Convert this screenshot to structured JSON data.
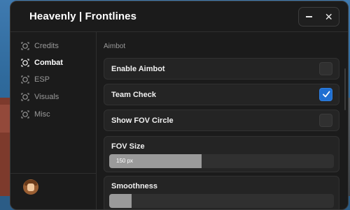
{
  "window": {
    "title": "Heavenly | Frontlines",
    "controls": {
      "minimize_icon": "minus-icon",
      "close_icon": "close-icon",
      "close_glyph": "✕"
    }
  },
  "sidebar": {
    "items": [
      {
        "label": "Credits",
        "icon": "target-icon",
        "active": false
      },
      {
        "label": "Combat",
        "icon": "target-icon",
        "active": true
      },
      {
        "label": "ESP",
        "icon": "target-icon",
        "active": false
      },
      {
        "label": "Visuals",
        "icon": "target-icon",
        "active": false
      },
      {
        "label": "Misc",
        "icon": "target-icon",
        "active": false
      }
    ]
  },
  "main": {
    "section_title": "Aimbot",
    "toggles": [
      {
        "label": "Enable Aimbot",
        "checked": false
      },
      {
        "label": "Team Check",
        "checked": true
      },
      {
        "label": "Show FOV Circle",
        "checked": false
      }
    ],
    "sliders": [
      {
        "label": "FOV Size",
        "value_text": "150 px",
        "fill_fraction": 0.41
      },
      {
        "label": "Smoothness",
        "value_text": "",
        "fill_fraction": 0.1
      }
    ]
  },
  "colors": {
    "accent": "#1f6fd1",
    "panel": "#1b1b1b",
    "row": "#242424",
    "slider_fill": "#9a9a9a"
  }
}
